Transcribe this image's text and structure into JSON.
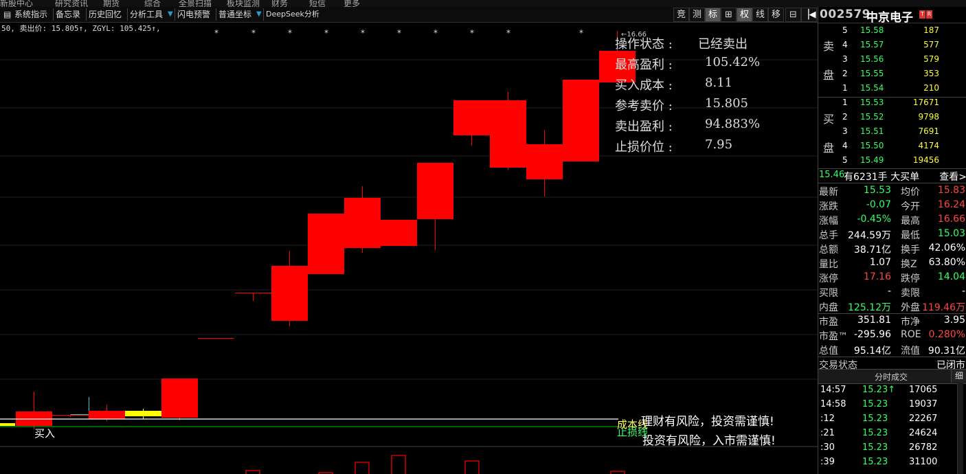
{
  "top_menu": [
    "新股中心",
    "研究资讯",
    "期货",
    "综合",
    "全景扫描",
    "板块监测",
    "财务",
    "短信",
    "更多"
  ],
  "toolbar": {
    "items": [
      "系统指示",
      "备忘录",
      "历史回忆",
      "分析工具",
      "闪电预警",
      "普通坐标",
      "DeepSeek分析"
    ],
    "right_buttons": [
      "竞",
      "测",
      "标",
      "⊞",
      "权",
      "线",
      "移",
      "⊟"
    ]
  },
  "info_line": "50, 卖出价: 15.805↑, ZGYL: 105.425↑,",
  "chart": {
    "high_label": "16.66",
    "buy_label": "买入",
    "cost_line_label": "成本线",
    "stop_line_label": "止损线",
    "risk_text_1": "理财有风险，投资需谨慎!",
    "risk_text_2": "投资有风险，入市需谨慎!",
    "marker_symbol": "*",
    "colors": {
      "up": "#ff0000",
      "background": "#000000",
      "gold": "#ffff00",
      "cost_line": "#ffffff",
      "stop_line": "#00cc00"
    }
  },
  "overlay": [
    {
      "label": "操作状态 :",
      "value": "已经卖出"
    },
    {
      "label": "最高盈利 :",
      "value": "105.42%"
    },
    {
      "label": "买入成本 :",
      "value": "8.11"
    },
    {
      "label": "参考卖价 :",
      "value": "15.805"
    },
    {
      "label": "卖出盈利 :",
      "value": "94.883%"
    },
    {
      "label": "止损价位 :",
      "value": "7.95"
    }
  ],
  "stock": {
    "code": "002579",
    "name": "中京电子",
    "badges": [
      "T",
      "R"
    ]
  },
  "order_book": {
    "sell_label": [
      "卖",
      "盘"
    ],
    "buy_label": [
      "买",
      "盘"
    ],
    "sell": [
      {
        "level": "5",
        "price": "15.58",
        "vol": "187"
      },
      {
        "level": "4",
        "price": "15.57",
        "vol": "577"
      },
      {
        "level": "3",
        "price": "15.56",
        "vol": "579"
      },
      {
        "level": "2",
        "price": "15.55",
        "vol": "353"
      },
      {
        "level": "1",
        "price": "15.54",
        "vol": "210"
      }
    ],
    "buy": [
      {
        "level": "1",
        "price": "15.53",
        "vol": "17671"
      },
      {
        "level": "2",
        "price": "15.52",
        "vol": "9798"
      },
      {
        "level": "3",
        "price": "15.51",
        "vol": "7691"
      },
      {
        "level": "4",
        "price": "15.50",
        "vol": "4174"
      },
      {
        "level": "5",
        "price": "15.49",
        "vol": "19456"
      }
    ]
  },
  "big_order": {
    "price": "15.46",
    "text": "有6231手 大买单",
    "link": "查看>"
  },
  "quote": [
    {
      "l": "最新",
      "v": "15.53",
      "vc": "green",
      "l2": "均价",
      "v2": "15.83",
      "v2c": "red"
    },
    {
      "l": "涨跌",
      "v": "-0.07",
      "vc": "green",
      "l2": "今开",
      "v2": "16.24",
      "v2c": "red"
    },
    {
      "l": "涨幅",
      "v": "-0.45%",
      "vc": "green",
      "l2": "最高",
      "v2": "16.66",
      "v2c": "red"
    },
    {
      "l": "总手",
      "v": "244.59万",
      "vc": "white",
      "l2": "最低",
      "v2": "15.03",
      "v2c": "green"
    },
    {
      "l": "总额",
      "v": "38.71亿",
      "vc": "white",
      "l2": "换手",
      "v2": "42.06%",
      "v2c": "white"
    },
    {
      "l": "量比",
      "v": "1.07",
      "vc": "white",
      "l2": "换Z",
      "v2": "63.80%",
      "v2c": "white"
    },
    {
      "l": "涨停",
      "v": "17.16",
      "vc": "red",
      "l2": "跌停",
      "v2": "14.04",
      "v2c": "green"
    },
    {
      "l": "买限",
      "v": "-",
      "vc": "white",
      "l2": "卖限",
      "v2": "-",
      "v2c": "white"
    },
    {
      "l": "内盘",
      "v": "125.12万",
      "vc": "green",
      "l2": "外盘",
      "v2": "119.46万",
      "v2c": "red"
    },
    {
      "l": "市盈",
      "v": "351.81",
      "vc": "white",
      "l2": "市净",
      "v2": "3.95",
      "v2c": "white"
    },
    {
      "l": "市盈™",
      "v": "-295.96",
      "vc": "white",
      "l2": "ROE",
      "v2": "0.280%",
      "v2c": "red"
    },
    {
      "l": "总值",
      "v": "95.14亿",
      "vc": "white",
      "l2": "流值",
      "v2": "90.31亿",
      "v2c": "white"
    },
    {
      "l": "交易状态",
      "v": "",
      "vc": "white",
      "l2": "",
      "v2": "已闭市",
      "v2c": "white"
    }
  ],
  "ticks_header": {
    "title": "分时成交",
    "btn": "细"
  },
  "ticks": [
    {
      "time": "14:57",
      "price": "15.23↑",
      "vol": "17065"
    },
    {
      "time": "14:58",
      "price": "15.23",
      "vol": "19037"
    },
    {
      "time": ":12",
      "price": "15.23",
      "vol": "22267"
    },
    {
      "time": ":21",
      "price": "15.23",
      "vol": "24624"
    },
    {
      "time": ":30",
      "price": "15.23",
      "vol": "26782"
    },
    {
      "time": ":39",
      "price": "15.23",
      "vol": "31100"
    }
  ]
}
